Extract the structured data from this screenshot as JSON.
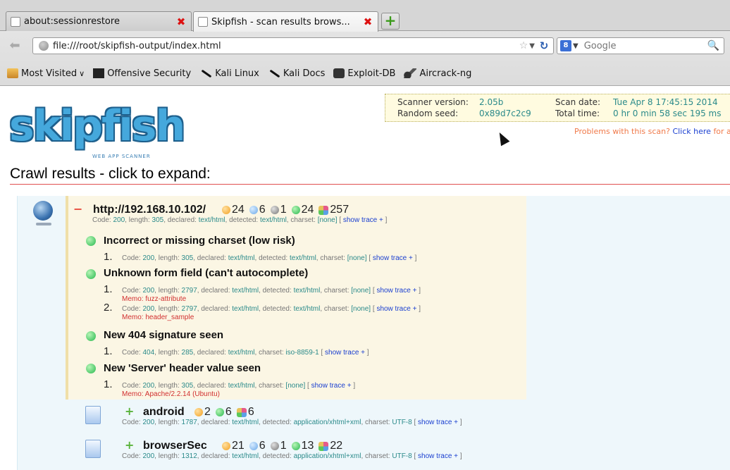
{
  "browser": {
    "tabs": [
      {
        "label": "about:sessionrestore"
      },
      {
        "label": "Skipfish - scan results brows..."
      }
    ],
    "url": "file:///root/skipfish-output/index.html",
    "search_placeholder": "Google",
    "search_engine": "8",
    "bookmarks": [
      {
        "label": "Most Visited",
        "icon": "folder-icon"
      },
      {
        "label": "Offensive Security",
        "icon": "offsec-icon"
      },
      {
        "label": "Kali Linux",
        "icon": "kali-dragon-icon"
      },
      {
        "label": "Kali Docs",
        "icon": "kali-dragon-icon"
      },
      {
        "label": "Exploit-DB",
        "icon": "exploitdb-icon"
      },
      {
        "label": "Aircrack-ng",
        "icon": "aircrack-icon"
      }
    ]
  },
  "report": {
    "logo_text": "skipfish",
    "logo_subtitle": "WEB APP SCANNER",
    "scanner_version_label": "Scanner version:",
    "scanner_version": "2.05b",
    "random_seed_label": "Random seed:",
    "random_seed": "0x89d7c2c9",
    "scan_date_label": "Scan date:",
    "scan_date": "Tue Apr 8 17:45:15 2014",
    "total_time_label": "Total time:",
    "total_time": "0 hr 0 min 58 sec 195 ms",
    "problems_text": "Problems with this scan?",
    "problems_link": "Click here",
    "problems_suffix": "for advice",
    "crawl_title": "Crawl results - click to expand:"
  },
  "root": {
    "url": "http://192.168.10.102/",
    "toggle": "−",
    "counts": {
      "orange": "24",
      "blue": "6",
      "gray": "1",
      "green": "24",
      "multi": "257"
    },
    "meta": {
      "code": "200",
      "length": "305",
      "declared": "text/html",
      "detected": "text/html",
      "charset": "[none]"
    }
  },
  "labels": {
    "code": "Code:",
    "length": "length:",
    "declared": "declared:",
    "detected": "detected:",
    "charset": "charset:",
    "trace_open": "[",
    "show_trace": "show trace +",
    "trace_close": "]",
    "memo": "Memo:",
    "plus": "+"
  },
  "issues": [
    {
      "title": "Incorrect or missing charset (low risk)",
      "samples": [
        {
          "num": "1.",
          "code": "200",
          "length": "305",
          "declared": "text/html",
          "detected": "text/html",
          "charset": "[none]"
        }
      ]
    },
    {
      "title": "Unknown form field (can't autocomplete)",
      "samples": [
        {
          "num": "1.",
          "code": "200",
          "length": "2797",
          "declared": "text/html",
          "detected": "text/html",
          "charset": "[none]",
          "memo": "fuzz-attribute"
        },
        {
          "num": "2.",
          "code": "200",
          "length": "2797",
          "declared": "text/html",
          "detected": "text/html",
          "charset": "[none]",
          "memo": "header_sample"
        }
      ]
    },
    {
      "title": "New 404 signature seen",
      "samples": [
        {
          "num": "1.",
          "code": "404",
          "length": "285",
          "declared": "text/html",
          "charset": "iso-8859-1"
        }
      ]
    },
    {
      "title": "New 'Server' header value seen",
      "samples": [
        {
          "num": "1.",
          "code": "200",
          "length": "305",
          "declared": "text/html",
          "charset": "[none]",
          "memo": "Apache/2.2.14 (Ubuntu)"
        }
      ]
    }
  ],
  "children": [
    {
      "name": "android",
      "counts": {
        "orange": "2",
        "green": "6",
        "multi": "6"
      },
      "meta": {
        "code": "200",
        "length": "1787",
        "declared": "text/html",
        "detected": "application/xhtml+xml",
        "charset": "UTF-8"
      }
    },
    {
      "name": "browserSec",
      "counts": {
        "orange": "21",
        "blue": "6",
        "gray": "1",
        "green": "13",
        "multi": "22"
      },
      "meta": {
        "code": "200",
        "length": "1312",
        "declared": "text/html",
        "detected": "application/xhtml+xml",
        "charset": "UTF-8"
      }
    }
  ]
}
